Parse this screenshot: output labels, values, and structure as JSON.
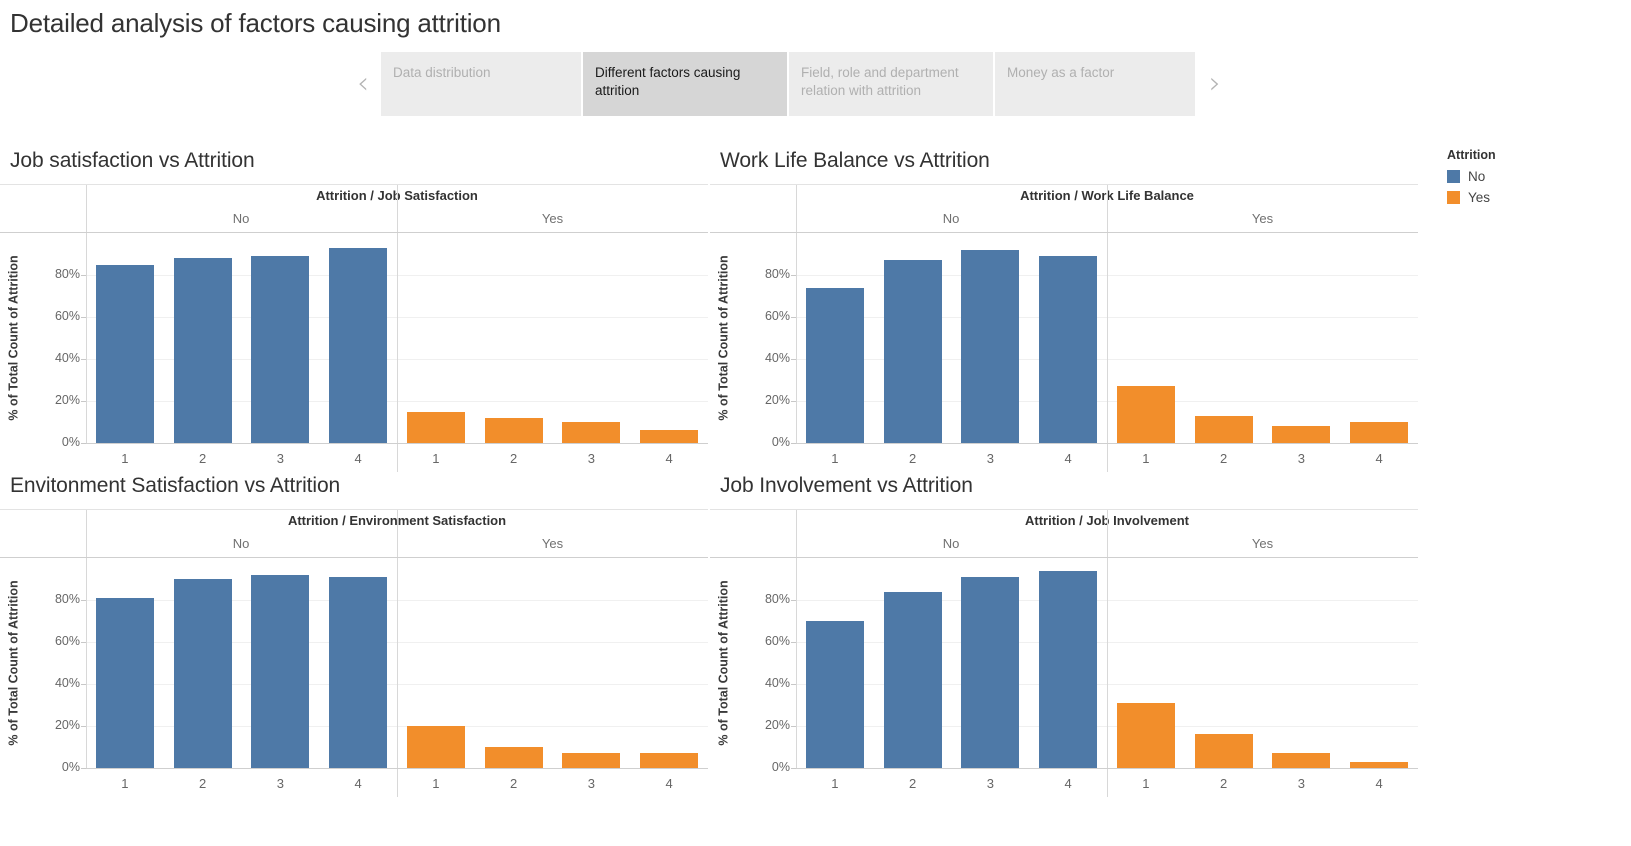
{
  "header": {
    "title": "Detailed analysis of factors causing attrition"
  },
  "nav": {
    "prev_icon": "chevron-left-icon",
    "next_icon": "chevron-right-icon",
    "prev_glyph": "‹",
    "next_glyph": "›",
    "tabs": [
      {
        "label": "Data distribution",
        "active": false
      },
      {
        "label": "Different factors causing attrition",
        "active": true
      },
      {
        "label": "Field, role and department relation with attrition",
        "active": false
      },
      {
        "label": "Money as a factor",
        "active": false
      }
    ]
  },
  "legend": {
    "title": "Attrition",
    "items": [
      {
        "label": "No",
        "color": "#4E79A7"
      },
      {
        "label": "Yes",
        "color": "#F28E2B"
      }
    ]
  },
  "colors": {
    "no": "#4E79A7",
    "yes": "#F28E2B",
    "tab_active_bg": "#d6d6d6",
    "tab_bg": "#ececec",
    "text": "#333333",
    "muted": "#707070"
  },
  "axis": {
    "ylabel": "% of Total Count of Attrition",
    "yticks": [
      "0%",
      "20%",
      "40%",
      "60%",
      "80%"
    ],
    "ytick_values": [
      0,
      20,
      40,
      60,
      80
    ],
    "ymin": 0,
    "ymax": 100,
    "panel_headers": [
      "No",
      "Yes"
    ],
    "categories": [
      "1",
      "2",
      "3",
      "4"
    ]
  },
  "chart_data": [
    {
      "type": "bar",
      "title": "Job satisfaction vs Attrition",
      "field_caption": "Attrition / Job Satisfaction",
      "xlabel": "",
      "ylabel": "% of Total Count of Attrition",
      "ylim": [
        0,
        100
      ],
      "grid": true,
      "legend_position": "right",
      "categories": [
        "1",
        "2",
        "3",
        "4"
      ],
      "panels": [
        "No",
        "Yes"
      ],
      "series": [
        {
          "name": "No",
          "color": "#4E79A7",
          "values": [
            85,
            88,
            89,
            93
          ]
        },
        {
          "name": "Yes",
          "color": "#F28E2B",
          "values": [
            15,
            12,
            10,
            6
          ]
        }
      ]
    },
    {
      "type": "bar",
      "title": "Work Life Balance vs Attrition",
      "field_caption": "Attrition / Work Life Balance",
      "xlabel": "",
      "ylabel": "% of Total Count of Attrition",
      "ylim": [
        0,
        100
      ],
      "grid": true,
      "legend_position": "right",
      "categories": [
        "1",
        "2",
        "3",
        "4"
      ],
      "panels": [
        "No",
        "Yes"
      ],
      "series": [
        {
          "name": "No",
          "color": "#4E79A7",
          "values": [
            74,
            87,
            92,
            89
          ]
        },
        {
          "name": "Yes",
          "color": "#F28E2B",
          "values": [
            27,
            13,
            8,
            10
          ]
        }
      ]
    },
    {
      "type": "bar",
      "title": "Envitonment Satisfaction vs Attrition",
      "field_caption": "Attrition / Environment Satisfaction",
      "xlabel": "",
      "ylabel": "% of Total Count of Attrition",
      "ylim": [
        0,
        100
      ],
      "grid": true,
      "legend_position": "right",
      "categories": [
        "1",
        "2",
        "3",
        "4"
      ],
      "panels": [
        "No",
        "Yes"
      ],
      "series": [
        {
          "name": "No",
          "color": "#4E79A7",
          "values": [
            81,
            90,
            92,
            91
          ]
        },
        {
          "name": "Yes",
          "color": "#F28E2B",
          "values": [
            20,
            10,
            7,
            7
          ]
        }
      ]
    },
    {
      "type": "bar",
      "title": "Job Involvement vs Attrition",
      "field_caption": "Attrition / Job Involvement",
      "xlabel": "",
      "ylabel": "% of Total Count of Attrition",
      "ylim": [
        0,
        100
      ],
      "grid": true,
      "legend_position": "right",
      "categories": [
        "1",
        "2",
        "3",
        "4"
      ],
      "panels": [
        "No",
        "Yes"
      ],
      "series": [
        {
          "name": "No",
          "color": "#4E79A7",
          "values": [
            70,
            84,
            91,
            94
          ]
        },
        {
          "name": "Yes",
          "color": "#F28E2B",
          "values": [
            31,
            16,
            7,
            3
          ]
        }
      ]
    }
  ]
}
